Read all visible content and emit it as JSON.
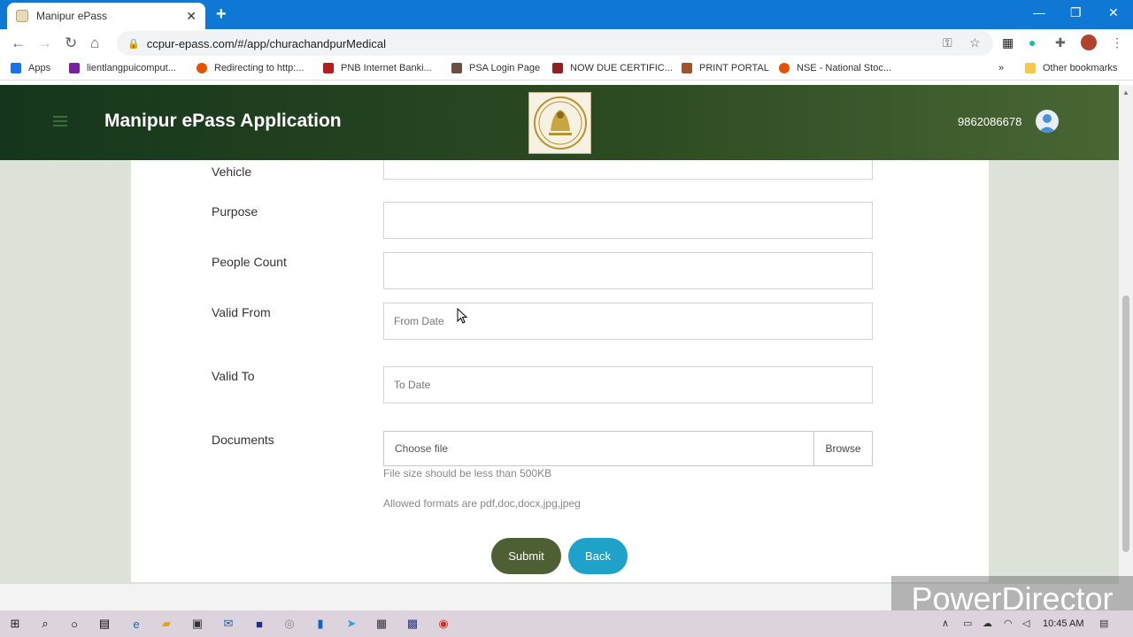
{
  "browser": {
    "tab_title": "Manipur ePass",
    "url": "ccpur-epass.com/#/app/churachandpurMedical",
    "bookmarks": [
      {
        "label": "Apps",
        "color": "#1a73e8"
      },
      {
        "label": "lientlangpuicomput...",
        "color": "#7a1fa2"
      },
      {
        "label": "Redirecting to http:...",
        "color": "#e65100"
      },
      {
        "label": "PNB Internet Banki...",
        "color": "#b71c1c"
      },
      {
        "label": "PSA Login Page",
        "color": "#6d4c41"
      },
      {
        "label": "NOW DUE CERTIFIC...",
        "color": "#8d2020"
      },
      {
        "label": "PRINT PORTAL",
        "color": "#a0522d"
      },
      {
        "label": "NSE - National Stoc...",
        "color": "#e65100"
      }
    ],
    "other_bookmarks": "Other bookmarks"
  },
  "header": {
    "title": "Manipur ePass Application",
    "phone": "9862086678"
  },
  "form": {
    "vehicle_label": "Vehicle",
    "purpose_label": "Purpose",
    "people_count_label": "People Count",
    "valid_from_label": "Valid From",
    "valid_from_placeholder": "From Date",
    "valid_to_label": "Valid To",
    "valid_to_placeholder": "To Date",
    "documents_label": "Documents",
    "choose_file": "Choose file",
    "browse": "Browse",
    "hint_size": "File size should be less than 500KB",
    "hint_formats": "Allowed formats are pdf,doc,docx,jpg,jpeg",
    "submit": "Submit",
    "back": "Back"
  },
  "watermark": "PowerDirector",
  "taskbar": {
    "time": "10:45 AM"
  }
}
